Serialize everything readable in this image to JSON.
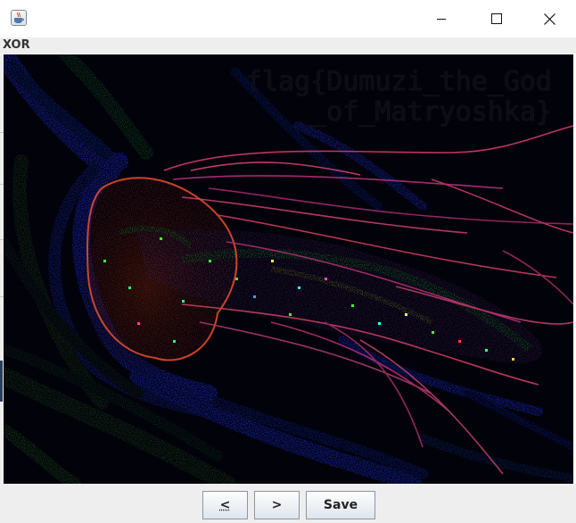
{
  "window": {
    "icon": "java-coffee-cup-icon",
    "controls": [
      "minimize-icon",
      "maximize-icon",
      "close-icon"
    ]
  },
  "panel": {
    "label": "XOR"
  },
  "image": {
    "overlay_line1": "flag{Dumuzi_the_God",
    "overlay_line2": "_of_Matryoshka}"
  },
  "buttons": {
    "prev_label": "<",
    "next_label": ">",
    "save_label": "Save"
  }
}
